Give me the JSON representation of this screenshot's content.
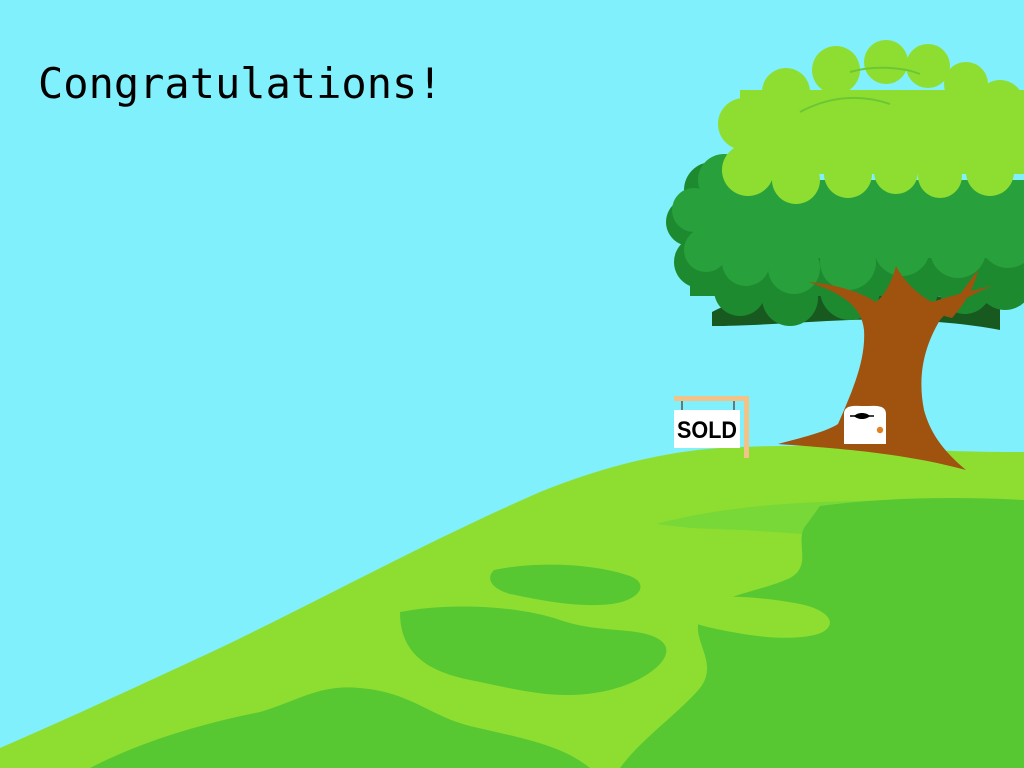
{
  "scene": {
    "message": "Congratulations!",
    "sign_text": "SOLD",
    "colors": {
      "sky": "#80f0fc",
      "hill_light": "#8ede32",
      "hill_mid": "#78d838",
      "hill_dark": "#58c832",
      "canopy_light": "#8ede32",
      "canopy_mid": "#28a03c",
      "canopy_dark": "#1e8a30",
      "canopy_shadow": "#17591f",
      "trunk": "#a0520f",
      "post": "#f2c286",
      "door": "#ffffff",
      "door_knob": "#e08020"
    },
    "icons": [
      "tree",
      "tree-door",
      "sold-sign"
    ]
  }
}
